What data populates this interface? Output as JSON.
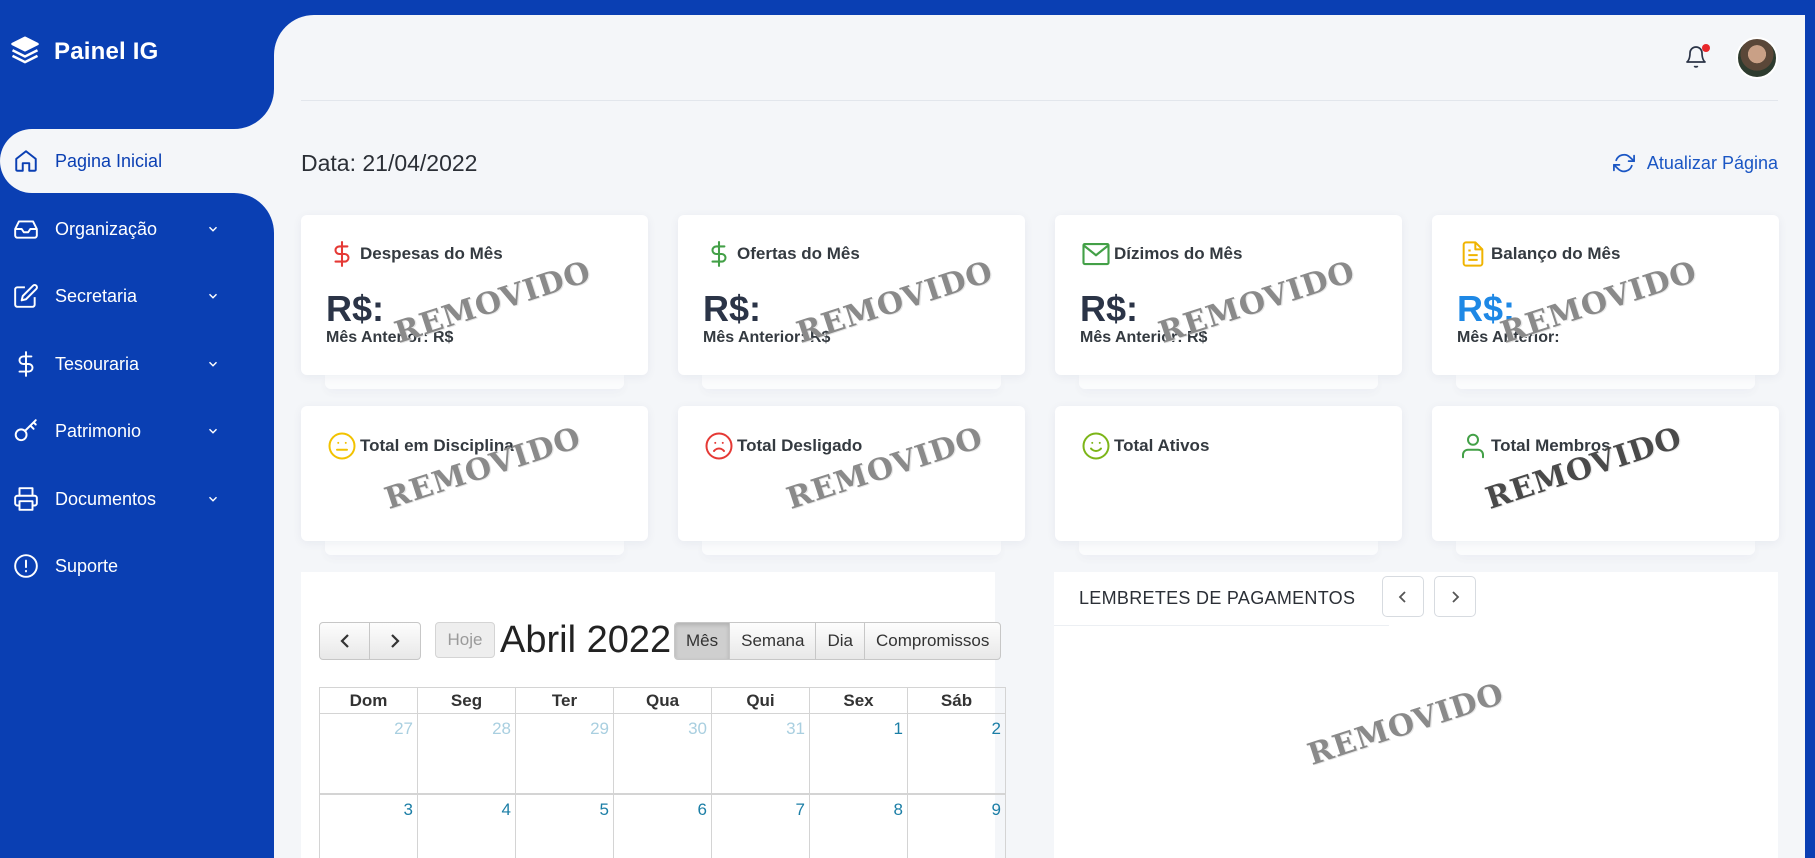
{
  "brand": {
    "title": "Painel IG"
  },
  "sidebar": {
    "items": [
      {
        "label": "Pagina Inicial",
        "icon": "home-icon",
        "active": true
      },
      {
        "label": "Organização",
        "icon": "inbox-icon",
        "expandable": true
      },
      {
        "label": "Secretaria",
        "icon": "edit-icon",
        "expandable": true
      },
      {
        "label": "Tesouraria",
        "icon": "dollar-icon",
        "expandable": true
      },
      {
        "label": "Patrimonio",
        "icon": "key-icon",
        "expandable": true
      },
      {
        "label": "Documentos",
        "icon": "printer-icon",
        "expandable": true
      },
      {
        "label": "Suporte",
        "icon": "alert-circle-icon"
      }
    ]
  },
  "header": {
    "date_label": "Data: 21/04/2022",
    "refresh_label": "Atualizar Página",
    "has_notification": true
  },
  "finance_cards": [
    {
      "title": "Despesas do Mês",
      "value": "R$:",
      "previous": "Mês Anterior: R$",
      "icon": "dollar-icon",
      "icon_color": "#e53935",
      "value_color": "#2b3447"
    },
    {
      "title": "Ofertas do Mês",
      "value": "R$:",
      "previous": "Mês Anterior: R$",
      "icon": "dollar-icon",
      "icon_color": "#43a047",
      "value_color": "#2b3447"
    },
    {
      "title": "Dízimos do Mês",
      "value": "R$:",
      "previous": "Mês Anterior: R$",
      "icon": "mail-icon",
      "icon_color": "#43a047",
      "value_color": "#2b3447"
    },
    {
      "title": "Balanço do Mês",
      "value": "R$:",
      "previous": "Mês Anterior:",
      "icon": "file-icon",
      "icon_color": "#f0b400",
      "value_color": "#1e88e5"
    }
  ],
  "member_cards": [
    {
      "title": "Total em Disciplina",
      "icon": "meh-icon",
      "icon_color": "#f2c200"
    },
    {
      "title": "Total Desligado",
      "icon": "frown-icon",
      "icon_color": "#e53935"
    },
    {
      "title": "Total Ativos",
      "icon": "smile-icon",
      "icon_color": "#7cb518"
    },
    {
      "title": "Total Membros",
      "icon": "user-icon",
      "icon_color": "#43a047"
    }
  ],
  "watermark": "REMOVIDO",
  "calendar": {
    "today_label": "Hoje",
    "title": "Abril 2022",
    "views": [
      "Mês",
      "Semana",
      "Dia",
      "Compromissos"
    ],
    "active_view": "Mês",
    "weekdays": [
      "Dom",
      "Seg",
      "Ter",
      "Qua",
      "Qui",
      "Sex",
      "Sáb"
    ],
    "weeks": [
      [
        {
          "d": "27",
          "o": true
        },
        {
          "d": "28",
          "o": true
        },
        {
          "d": "29",
          "o": true
        },
        {
          "d": "30",
          "o": true
        },
        {
          "d": "31",
          "o": true
        },
        {
          "d": "1"
        },
        {
          "d": "2"
        }
      ],
      [
        {
          "d": "3"
        },
        {
          "d": "4"
        },
        {
          "d": "5"
        },
        {
          "d": "6"
        },
        {
          "d": "7"
        },
        {
          "d": "8"
        },
        {
          "d": "9"
        }
      ]
    ]
  },
  "reminders": {
    "title": "LEMBRETES DE PAGAMENTOS"
  }
}
